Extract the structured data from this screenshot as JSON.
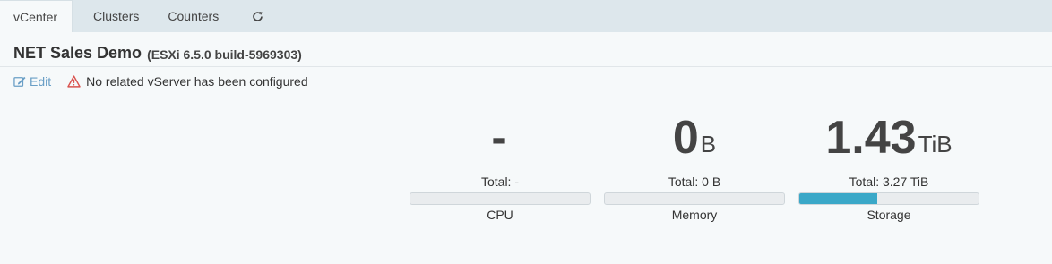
{
  "tabs": [
    {
      "label": "vCenter",
      "active": true
    },
    {
      "label": "Clusters",
      "active": false
    },
    {
      "label": "Counters",
      "active": false
    }
  ],
  "refresh_icon": "refresh-icon",
  "header": {
    "title": "NET Sales Demo",
    "subtitle": "(ESXi 6.5.0 build-5969303)"
  },
  "actions": {
    "edit_label": "Edit",
    "edit_icon": "edit-icon",
    "warning_icon": "warning-triangle-icon",
    "warning_text": "No related vServer has been configured"
  },
  "colors": {
    "accent_link": "#6a9fc6",
    "warning": "#d9534f",
    "bar_fill": "#3aa8c8"
  },
  "stats": [
    {
      "value": "-",
      "unit": "",
      "total": "Total: -",
      "label": "CPU",
      "fill": 0
    },
    {
      "value": "0",
      "unit": "B",
      "total": "Total: 0 B",
      "label": "Memory",
      "fill": 0
    },
    {
      "value": "1.43",
      "unit": "TiB",
      "total": "Total: 3.27 TiB",
      "label": "Storage",
      "fill": 0.437
    }
  ]
}
